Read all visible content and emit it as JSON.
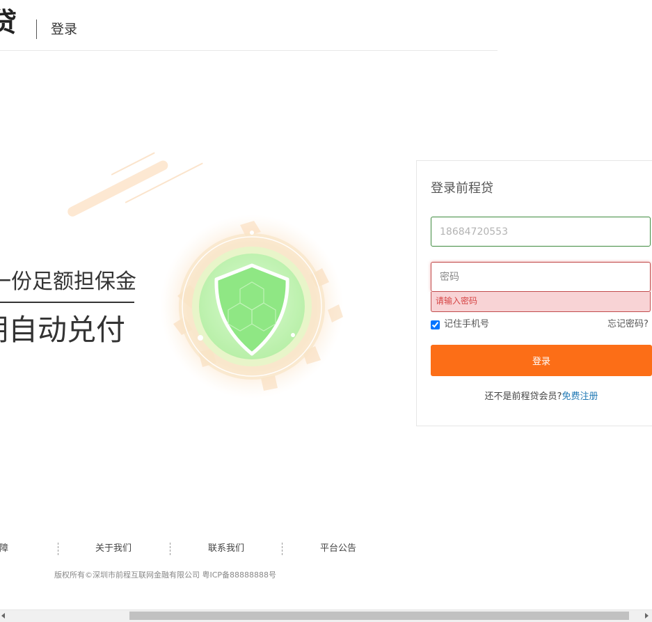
{
  "header": {
    "logo_text": "贷",
    "page_title": "登录"
  },
  "banner": {
    "slogan_line1": "一份足额担保金",
    "slogan_line2": "期自动兑付",
    "shield_icon": "shield-icon"
  },
  "login": {
    "title": "登录前程贷",
    "phone_placeholder": "18684720553",
    "password_placeholder": "密码",
    "password_error": "请输入密码",
    "remember_label": "记住手机号",
    "remember_checked": true,
    "forgot_label": "忘记密码?",
    "submit_label": "登录",
    "register_prompt": "还不是前程贷会员?",
    "register_link": "免费注册",
    "colors": {
      "accent": "#fc6e17",
      "link": "#1f78b4",
      "error": "#d64545",
      "valid_border": "#3d8a3d"
    }
  },
  "footer": {
    "links": [
      "安全保障",
      "关于我们",
      "联系我们",
      "平台公告"
    ],
    "copyright": "版权所有©深圳市前程互联网金融有限公司 粤ICP备88888888号"
  }
}
